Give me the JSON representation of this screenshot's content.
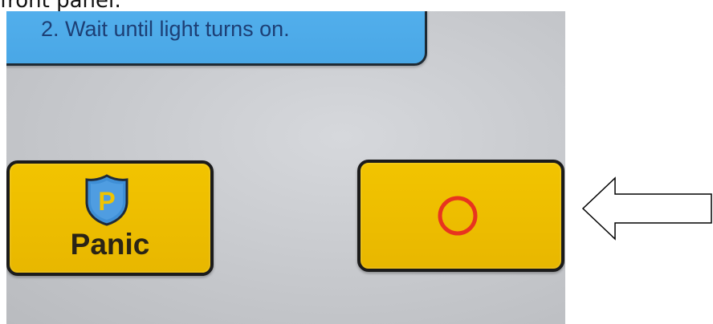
{
  "caption": "front panel:",
  "instruction": {
    "step_text": "2. Wait until light turns on."
  },
  "panic_button": {
    "icon_letter": "P",
    "label": "Panic"
  },
  "colors": {
    "instruction_blue": "#4fadea",
    "key_yellow": "#eebe00",
    "ring_red": "#e8341f",
    "shield_blue": "#3f8fd6",
    "panel_gray": "#c9cbcf"
  },
  "icons": {
    "panic_icon": "shield-p-icon",
    "power_icon": "power-ring-icon",
    "pointer": "left-arrow-icon"
  }
}
